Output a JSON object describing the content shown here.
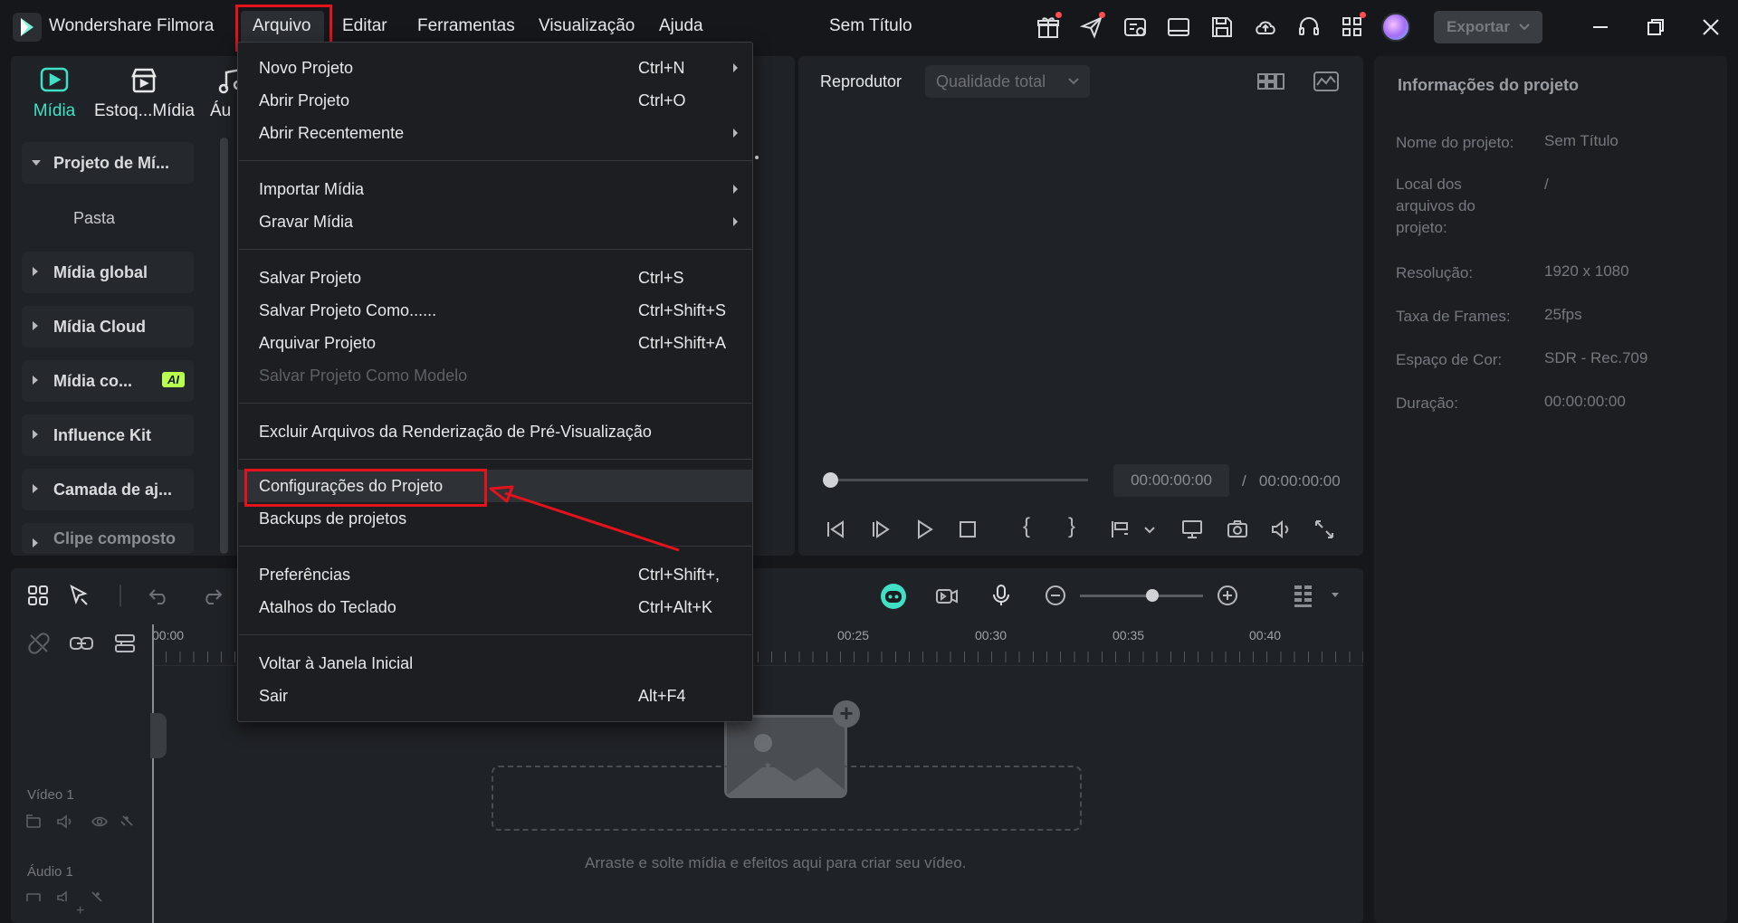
{
  "app": {
    "name": "Wondershare Filmora",
    "window_title": "Sem Título",
    "export_label": "Exportar"
  },
  "menubar": {
    "items": [
      "Arquivo",
      "Editar",
      "Ferramentas",
      "Visualização",
      "Ajuda"
    ]
  },
  "media_tabs": [
    {
      "label": "Mídia",
      "icon": "media-icon",
      "active": true
    },
    {
      "label": "Estoq...Mídia",
      "icon": "stock-media-icon"
    },
    {
      "label": "Áu",
      "icon": "audio-icon"
    }
  ],
  "sidebar": {
    "items": [
      {
        "label": "Projeto de Mí...",
        "open": true
      },
      {
        "label": "Pasta"
      },
      {
        "label": "Mídia global"
      },
      {
        "label": "Mídia Cloud"
      },
      {
        "label": "Mídia co...",
        "badge": "AI"
      },
      {
        "label": "Influence Kit"
      },
      {
        "label": "Camada de aj..."
      },
      {
        "label": "Clipe composto"
      }
    ]
  },
  "player": {
    "label": "Reprodutor",
    "quality": "Qualidade total",
    "current_time": "00:00:00:00",
    "separator": "/",
    "total_time": "00:00:00:00"
  },
  "project_info": {
    "title": "Informações do projeto",
    "rows": [
      {
        "label": "Nome do projeto:",
        "value": "Sem Título"
      },
      {
        "label": "Local dos arquivos do projeto:",
        "value": "/"
      },
      {
        "label": "Resolução:",
        "value": "1920 x 1080"
      },
      {
        "label": "Taxa de Frames:",
        "value": "25fps"
      },
      {
        "label": "Espaço de Cor:",
        "value": "SDR - Rec.709"
      },
      {
        "label": "Duração:",
        "value": "00:00:00:00"
      }
    ]
  },
  "timeline": {
    "ruler": [
      "00:00",
      "00:25",
      "00:30",
      "00:35",
      "00:40"
    ],
    "tracks": [
      {
        "label": "Vídeo 1"
      },
      {
        "label": "Áudio 1"
      }
    ],
    "drop_hint": "Arraste e solte mídia e efeitos aqui para criar seu vídeo."
  },
  "file_menu": {
    "items": [
      {
        "label": "Novo Projeto",
        "shortcut": "Ctrl+N",
        "submenu": true
      },
      {
        "label": "Abrir Projeto",
        "shortcut": "Ctrl+O"
      },
      {
        "label": "Abrir Recentemente",
        "shortcut": "",
        "submenu": true
      },
      {
        "label": "Importar Mídia",
        "shortcut": "",
        "submenu": true
      },
      {
        "label": "Gravar Mídia",
        "shortcut": "",
        "submenu": true
      },
      {
        "label": "Salvar Projeto",
        "shortcut": "Ctrl+S"
      },
      {
        "label": "Salvar Projeto Como......",
        "shortcut": "Ctrl+Shift+S"
      },
      {
        "label": "Arquivar Projeto",
        "shortcut": "Ctrl+Shift+A"
      },
      {
        "label": "Salvar Projeto Como Modelo",
        "shortcut": "",
        "disabled": true
      },
      {
        "label": "Excluir Arquivos da Renderização de Pré-Visualização",
        "shortcut": ""
      },
      {
        "label": "Configurações do Projeto",
        "shortcut": "",
        "highlighted": true
      },
      {
        "label": "Backups de projetos",
        "shortcut": ""
      },
      {
        "label": "Preferências",
        "shortcut": "Ctrl+Shift+,"
      },
      {
        "label": "Atalhos do Teclado",
        "shortcut": "Ctrl+Alt+K"
      },
      {
        "label": "Voltar à Janela Inicial",
        "shortcut": ""
      },
      {
        "label": "Sair",
        "shortcut": "Alt+F4"
      }
    ]
  },
  "colors": {
    "background": "#15171b",
    "panel": "#1f2226",
    "accent": "#3fe0c5",
    "annotation": "#e4121b"
  }
}
